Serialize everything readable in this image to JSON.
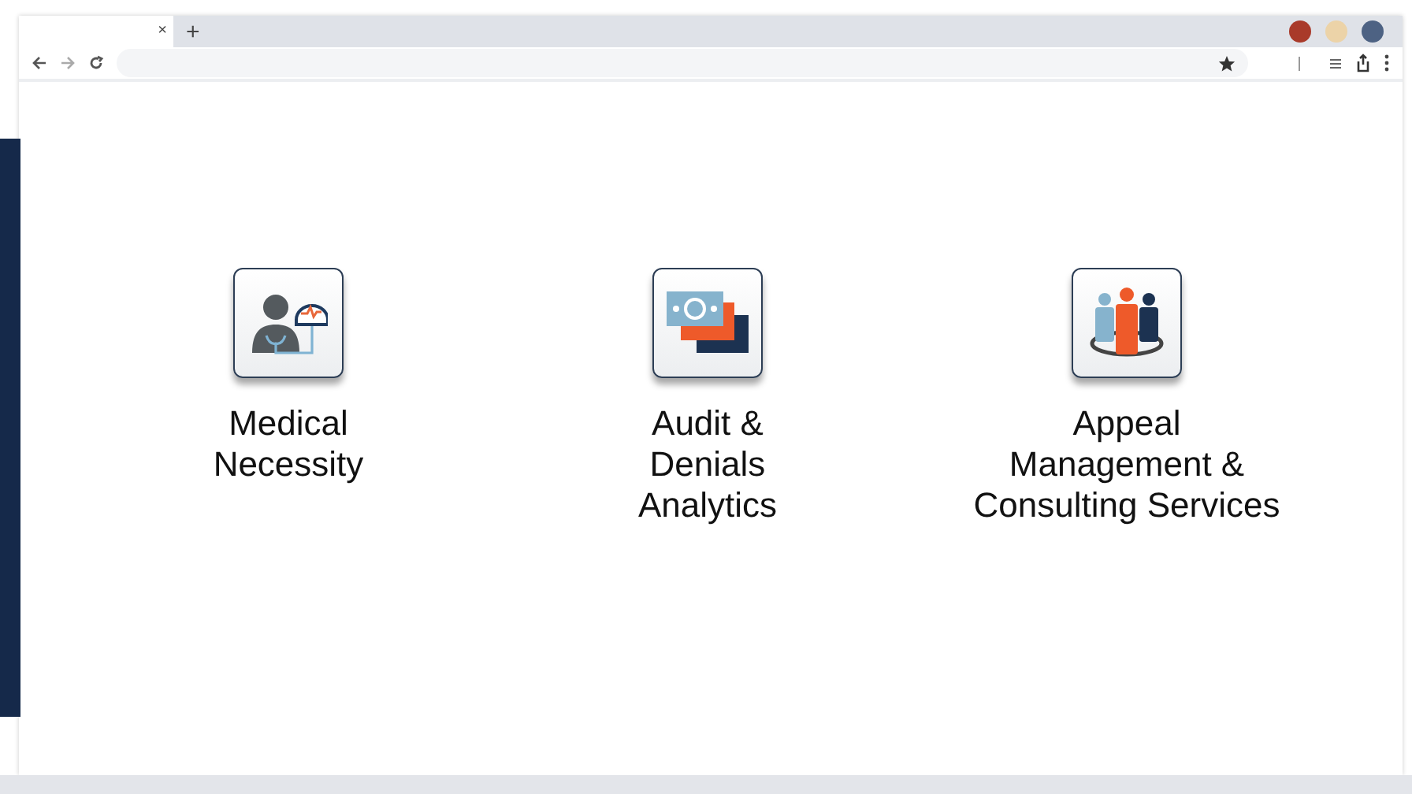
{
  "browser": {
    "tab_close": "×",
    "new_tab": "+"
  },
  "services": [
    {
      "kind": "doctor",
      "label_lines": [
        "Medical",
        "Necessity"
      ]
    },
    {
      "kind": "money",
      "label_lines": [
        "Audit &",
        "Denials",
        "Analytics"
      ]
    },
    {
      "kind": "team",
      "label_lines": [
        "Appeal",
        "Management &",
        "Consulting Services"
      ]
    }
  ]
}
